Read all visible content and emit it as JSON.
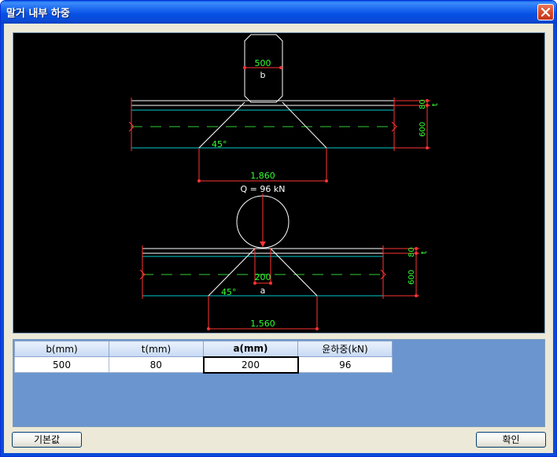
{
  "window": {
    "title": "말거 내부 하중"
  },
  "drawing": {
    "top": {
      "width_value": "500",
      "width_symbol": "b",
      "thickness_value": "80",
      "thickness_symbol": "t",
      "depth_value": "600",
      "angle_label": "45°",
      "spread_value": "1,860"
    },
    "bottom": {
      "load_label": "Q = 96 kN",
      "width_value": "200",
      "width_symbol": "a",
      "thickness_value": "80",
      "thickness_symbol": "t",
      "depth_value": "600",
      "angle_label": "45°",
      "spread_value": "1,560"
    }
  },
  "grid": {
    "headers": [
      "b(mm)",
      "t(mm)",
      "a(mm)",
      "윤하중(kN)"
    ],
    "values": [
      "500",
      "80",
      "200",
      "96"
    ]
  },
  "buttons": {
    "default_label": "기본값",
    "ok_label": "확인"
  },
  "colors": {
    "title_bar": "#0a5ee8",
    "canvas_bg": "#000000",
    "dimension": "#ff3333",
    "dimension_text": "#33ff33",
    "outline": "#ffffff",
    "centerline": "#33cc33",
    "grid_bg": "#6b95cf"
  }
}
